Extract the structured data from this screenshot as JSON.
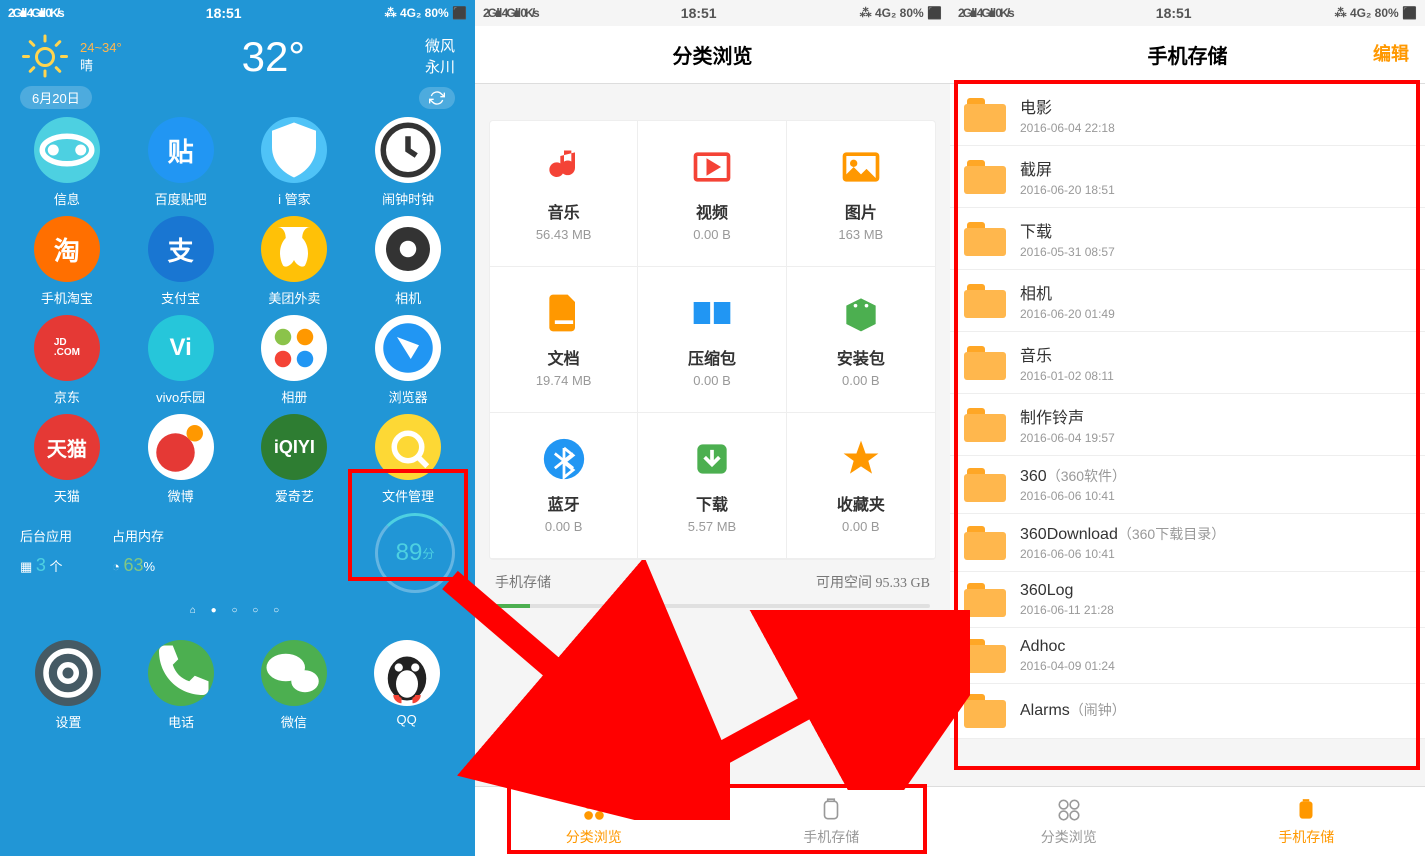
{
  "status": {
    "signal": "2Gılıl 4Gılıl 0K/s",
    "time": "18:51",
    "battery": "⁂ 4G₂ 80% ⬛"
  },
  "phone1": {
    "weather": {
      "range": "24~34°",
      "cond": "晴",
      "temp": "32°",
      "wind": "微风",
      "city": "永川",
      "date": "6月20日"
    },
    "apps": [
      {
        "label": "信息",
        "bg": "#4dd0e1",
        "glyph": "msg"
      },
      {
        "label": "百度贴吧",
        "bg": "#2196f3",
        "glyph": "tieba"
      },
      {
        "label": "i 管家",
        "bg": "#4fc3f7",
        "glyph": "shield"
      },
      {
        "label": "闹钟时钟",
        "bg": "#fff",
        "glyph": "clock"
      },
      {
        "label": "手机淘宝",
        "bg": "#ff6f00",
        "glyph": "taobao"
      },
      {
        "label": "支付宝",
        "bg": "#1976d2",
        "glyph": "alipay"
      },
      {
        "label": "美团外卖",
        "bg": "#ffc107",
        "glyph": "meituan"
      },
      {
        "label": "相机",
        "bg": "#fff",
        "glyph": "camera"
      },
      {
        "label": "京东",
        "bg": "#e53935",
        "glyph": "jd"
      },
      {
        "label": "vivo乐园",
        "bg": "#26c6da",
        "glyph": "vivo"
      },
      {
        "label": "相册",
        "bg": "#fff",
        "glyph": "gallery"
      },
      {
        "label": "浏览器",
        "bg": "#fff",
        "glyph": "browser"
      },
      {
        "label": "天猫",
        "bg": "#e53935",
        "glyph": "tmall"
      },
      {
        "label": "微博",
        "bg": "#fff",
        "glyph": "weibo"
      },
      {
        "label": "爱奇艺",
        "bg": "#2e7d32",
        "glyph": "iqiyi"
      },
      {
        "label": "文件管理",
        "bg": "#fdd835",
        "glyph": "filemgr"
      }
    ],
    "stats": {
      "bg_apps_label": "后台应用",
      "bg_apps": "3",
      "bg_unit": "个",
      "mem_label": "占用内存",
      "mem": "63",
      "mem_unit": "%",
      "score": "89",
      "score_unit": "分"
    },
    "dock": [
      {
        "label": "设置",
        "bg": "#455a64",
        "glyph": "settings"
      },
      {
        "label": "电话",
        "bg": "#4caf50",
        "glyph": "phone"
      },
      {
        "label": "微信",
        "bg": "#4caf50",
        "glyph": "wechat"
      },
      {
        "label": "QQ",
        "bg": "#fff",
        "glyph": "qq"
      }
    ]
  },
  "phone2": {
    "title": "分类浏览",
    "cats": [
      {
        "name": "音乐",
        "size": "56.43 MB",
        "icon": "music",
        "color": "#f44336"
      },
      {
        "name": "视频",
        "size": "0.00 B",
        "icon": "video",
        "color": "#f44336"
      },
      {
        "name": "图片",
        "size": "163 MB",
        "icon": "image",
        "color": "#ff9800"
      },
      {
        "name": "文档",
        "size": "19.74 MB",
        "icon": "doc",
        "color": "#ff9800"
      },
      {
        "name": "压缩包",
        "size": "0.00 B",
        "icon": "zip",
        "color": "#2196f3"
      },
      {
        "name": "安装包",
        "size": "0.00 B",
        "icon": "apk",
        "color": "#4caf50"
      },
      {
        "name": "蓝牙",
        "size": "0.00 B",
        "icon": "bt",
        "color": "#2196f3"
      },
      {
        "name": "下载",
        "size": "5.57 MB",
        "icon": "dl",
        "color": "#4caf50"
      },
      {
        "name": "收藏夹",
        "size": "0.00 B",
        "icon": "star",
        "color": "#ff9800"
      }
    ],
    "storage_label": "手机存储",
    "free_label": "可用空间",
    "free_value": "95.33 GB",
    "tab1": "分类浏览",
    "tab2": "手机存储"
  },
  "phone3": {
    "title": "手机存储",
    "edit": "编辑",
    "folders": [
      {
        "name": "电影",
        "note": "",
        "date": "2016-06-04 22:18"
      },
      {
        "name": "截屏",
        "note": "",
        "date": "2016-06-20 18:51"
      },
      {
        "name": "下载",
        "note": "",
        "date": "2016-05-31 08:57"
      },
      {
        "name": "相机",
        "note": "",
        "date": "2016-06-20 01:49"
      },
      {
        "name": "音乐",
        "note": "",
        "date": "2016-01-02 08:11"
      },
      {
        "name": "制作铃声",
        "note": "",
        "date": "2016-06-04 19:57"
      },
      {
        "name": "360",
        "note": "（360软件）",
        "date": "2016-06-06 10:41"
      },
      {
        "name": "360Download",
        "note": "（360下载目录）",
        "date": "2016-06-06 10:41"
      },
      {
        "name": "360Log",
        "note": "",
        "date": "2016-06-11 21:28"
      },
      {
        "name": "Adhoc",
        "note": "",
        "date": "2016-04-09 01:24"
      },
      {
        "name": "Alarms",
        "note": "（闹钟）",
        "date": ""
      }
    ],
    "tab1": "分类浏览",
    "tab2": "手机存储"
  }
}
